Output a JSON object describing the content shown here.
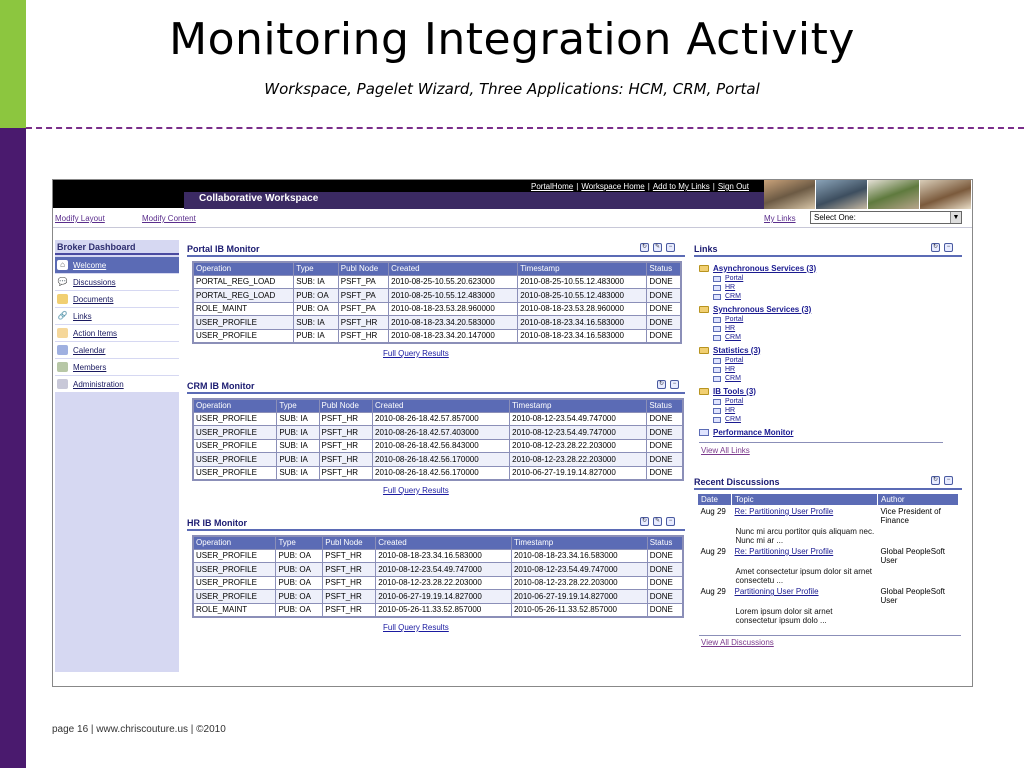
{
  "slide": {
    "title": "Monitoring Integration Activity",
    "subtitle": "Workspace, Pagelet Wizard, Three Applications: HCM, CRM, Portal",
    "footer": "page 16 | www.chriscouture.us | ©2010"
  },
  "app": {
    "top_links": [
      "PortalHome",
      "Workspace Home",
      "Add to My Links",
      "Sign Out"
    ],
    "workspace_title": "Collaborative Workspace",
    "modify_layout": "Modify Layout",
    "modify_content": "Modify Content",
    "my_links_label": "My Links",
    "my_links_select": "Select One:"
  },
  "sidebar": {
    "title": "Broker Dashboard",
    "items": [
      {
        "label": "Welcome",
        "icon": "home-icon"
      },
      {
        "label": "Discussions",
        "icon": "speech-bubble-icon"
      },
      {
        "label": "Documents",
        "icon": "folder-icon"
      },
      {
        "label": "Links",
        "icon": "link-icon"
      },
      {
        "label": "Action Items",
        "icon": "checklist-icon"
      },
      {
        "label": "Calendar",
        "icon": "calendar-icon"
      },
      {
        "label": "Members",
        "icon": "people-icon"
      },
      {
        "label": "Administration",
        "icon": "admin-icon"
      }
    ]
  },
  "monitors": {
    "columns": [
      "Operation",
      "Type",
      "Publ Node",
      "Created",
      "Timestamp",
      "Status"
    ],
    "full_query": "Full Query Results",
    "portal": {
      "title": "Portal IB Monitor",
      "rows": [
        [
          "PORTAL_REG_LOAD",
          "SUB: IA",
          "PSFT_PA",
          "2010-08-25-10.55.20.623000",
          "2010-08-25-10.55.12.483000",
          "DONE"
        ],
        [
          "PORTAL_REG_LOAD",
          "PUB: OA",
          "PSFT_PA",
          "2010-08-25-10.55.12.483000",
          "2010-08-25-10.55.12.483000",
          "DONE"
        ],
        [
          "ROLE_MAINT",
          "PUB: OA",
          "PSFT_PA",
          "2010-08-18-23.53.28.960000",
          "2010-08-18-23.53.28.960000",
          "DONE"
        ],
        [
          "USER_PROFILE",
          "SUB: IA",
          "PSFT_HR",
          "2010-08-18-23.34.20.583000",
          "2010-08-18-23.34.16.583000",
          "DONE"
        ],
        [
          "USER_PROFILE",
          "PUB: IA",
          "PSFT_HR",
          "2010-08-18-23.34.20.147000",
          "2010-08-18-23.34.16.583000",
          "DONE"
        ]
      ]
    },
    "crm": {
      "title": "CRM IB Monitor",
      "rows": [
        [
          "USER_PROFILE",
          "SUB: IA",
          "PSFT_HR",
          "2010-08-26-18.42.57.857000",
          "2010-08-12-23.54.49.747000",
          "DONE"
        ],
        [
          "USER_PROFILE",
          "PUB: IA",
          "PSFT_HR",
          "2010-08-26-18.42.57.403000",
          "2010-08-12-23.54.49.747000",
          "DONE"
        ],
        [
          "USER_PROFILE",
          "SUB: IA",
          "PSFT_HR",
          "2010-08-26-18.42.56.843000",
          "2010-08-12-23.28.22.203000",
          "DONE"
        ],
        [
          "USER_PROFILE",
          "PUB: IA",
          "PSFT_HR",
          "2010-08-26-18.42.56.170000",
          "2010-08-12-23.28.22.203000",
          "DONE"
        ],
        [
          "USER_PROFILE",
          "SUB: IA",
          "PSFT_HR",
          "2010-08-26-18.42.56.170000",
          "2010-06-27-19.19.14.827000",
          "DONE"
        ]
      ]
    },
    "hr": {
      "title": "HR IB Monitor",
      "rows": [
        [
          "USER_PROFILE",
          "PUB: OA",
          "PSFT_HR",
          "2010-08-18-23.34.16.583000",
          "2010-08-18-23.34.16.583000",
          "DONE"
        ],
        [
          "USER_PROFILE",
          "PUB: OA",
          "PSFT_HR",
          "2010-08-12-23.54.49.747000",
          "2010-08-12-23.54.49.747000",
          "DONE"
        ],
        [
          "USER_PROFILE",
          "PUB: OA",
          "PSFT_HR",
          "2010-08-12-23.28.22.203000",
          "2010-08-12-23.28.22.203000",
          "DONE"
        ],
        [
          "USER_PROFILE",
          "PUB: OA",
          "PSFT_HR",
          "2010-06-27-19.19.14.827000",
          "2010-06-27-19.19.14.827000",
          "DONE"
        ],
        [
          "ROLE_MAINT",
          "PUB: OA",
          "PSFT_HR",
          "2010-05-26-11.33.52.857000",
          "2010-05-26-11.33.52.857000",
          "DONE"
        ]
      ]
    }
  },
  "links": {
    "title": "Links",
    "groups": [
      {
        "label": "Asynchronous Services (3)",
        "items": [
          "Portal",
          "HR",
          "CRM"
        ]
      },
      {
        "label": "Synchronous Services (3)",
        "items": [
          "Portal",
          "HR",
          "CRM"
        ]
      },
      {
        "label": "Statistics (3)",
        "items": [
          "Portal",
          "HR",
          "CRM"
        ]
      },
      {
        "label": "IB Tools (3)",
        "items": [
          "Portal",
          "HR",
          "CRM"
        ]
      }
    ],
    "performance_monitor": "Performance Monitor",
    "view_all": "View All Links"
  },
  "discussions": {
    "title": "Recent Discussions",
    "columns": [
      "Date",
      "Topic",
      "Author"
    ],
    "rows": [
      {
        "date": "Aug 29",
        "topic": "Re: Partitioning User Profile",
        "author": "Vice President of Finance",
        "body": "Nunc mi arcu portitor quis aliquam nec. Nunc mi ar ..."
      },
      {
        "date": "Aug 29",
        "topic": "Re: Partitioning User Profile",
        "author": "Global PeopleSoft User",
        "body": "Amet consectetur ipsum dolor sit arnet consectetu ..."
      },
      {
        "date": "Aug 29",
        "topic": "Partitioning User Profile",
        "author": "Global PeopleSoft User",
        "body": "Lorem ipsum dolor sit arnet consectetur ipsum dolo ..."
      }
    ],
    "view_all": "View All Discussions"
  },
  "colors": {
    "accent_green": "#8cc63f",
    "accent_purple": "#4a1a6e",
    "header_blue": "#5b6bb5",
    "workspace_bar": "#3b2a63"
  }
}
